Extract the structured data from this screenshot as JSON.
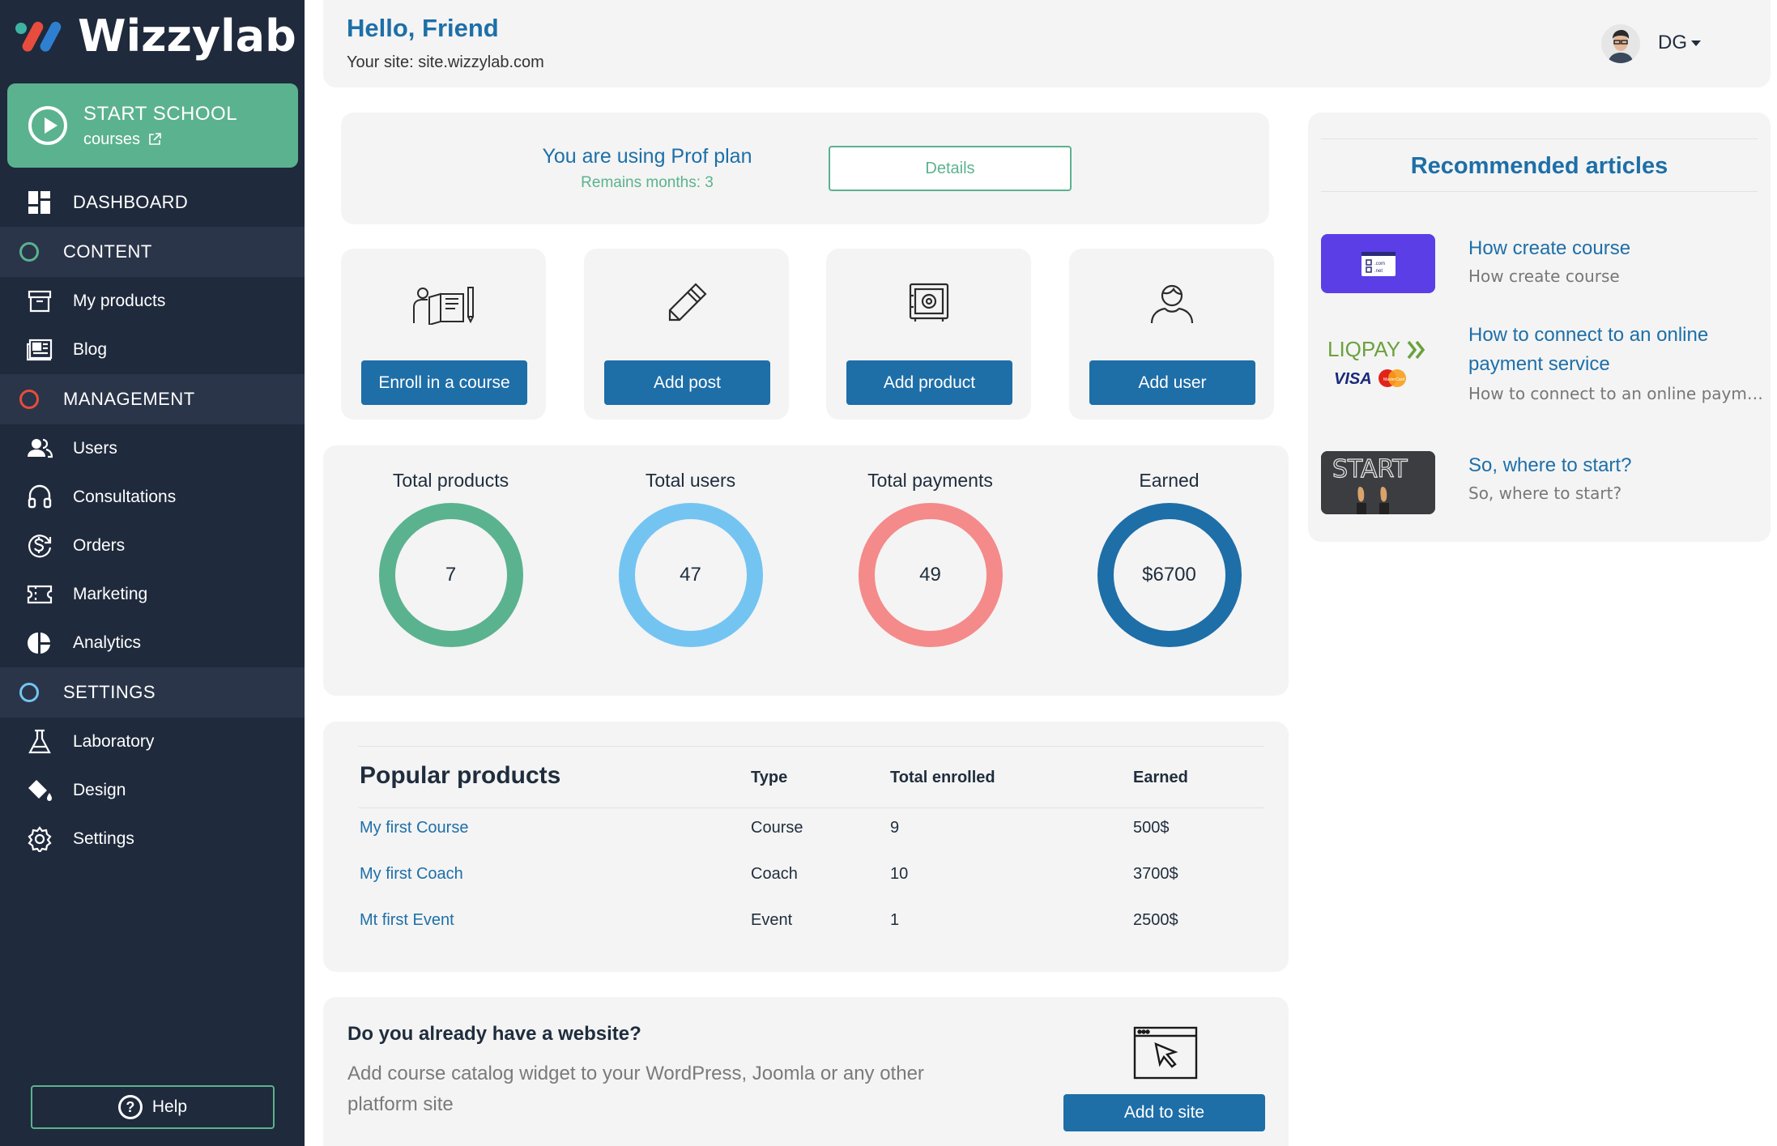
{
  "brand": {
    "name": "Wizzylab"
  },
  "start_school": {
    "title": "START SCHOOL",
    "subtitle": "courses"
  },
  "nav": {
    "dashboard": "DASHBOARD",
    "content": "CONTENT",
    "my_products": "My products",
    "blog": "Blog",
    "management": "MANAGEMENT",
    "users": "Users",
    "consultations": "Consultations",
    "orders": "Orders",
    "marketing": "Marketing",
    "analytics": "Analytics",
    "settings_section": "SETTINGS",
    "laboratory": "Laboratory",
    "design": "Design",
    "settings": "Settings"
  },
  "help": {
    "label": "Help"
  },
  "header": {
    "greeting": "Hello, Friend",
    "site_prefix": "Your site:",
    "site_url": "site.wizzylab.com",
    "user_initials": "DG"
  },
  "plan": {
    "title": "You are using Prof plan",
    "remains": "Remains months: 3",
    "details_label": "Details"
  },
  "actions": [
    {
      "label": "Enroll in a course",
      "icon": "book-reader-icon"
    },
    {
      "label": "Add post",
      "icon": "pencil-icon"
    },
    {
      "label": "Add product",
      "icon": "safe-icon"
    },
    {
      "label": "Add user",
      "icon": "user-icon"
    }
  ],
  "stats": [
    {
      "label": "Total products",
      "value": "7",
      "color": "#5bb28f"
    },
    {
      "label": "Total users",
      "value": "47",
      "color": "#74c4f2"
    },
    {
      "label": "Total payments",
      "value": "49",
      "color": "#f48a8a"
    },
    {
      "label": "Earned",
      "value": "$6700",
      "color": "#1e6ea8"
    }
  ],
  "popular": {
    "title": "Popular products",
    "columns": [
      "Type",
      "Total enrolled",
      "Earned"
    ],
    "rows": [
      {
        "name": "My first Course",
        "type": "Course",
        "enrolled": "9",
        "earned": "500$"
      },
      {
        "name": "My first Coach",
        "type": "Coach",
        "enrolled": "10",
        "earned": "3700$"
      },
      {
        "name": "Mt first Event",
        "type": "Event",
        "enrolled": "1",
        "earned": "2500$"
      }
    ]
  },
  "website": {
    "title": "Do you already have a website?",
    "description": "Add course catalog widget to your WordPress, Joomla or any other platform site",
    "button": "Add to site"
  },
  "articles": {
    "title": "Recommended articles",
    "items": [
      {
        "title": "How create course",
        "subtitle": "How create course"
      },
      {
        "title": "How to connect to an online payment service",
        "subtitle": "How to connect to an online payment service"
      },
      {
        "title": "So, where to start?",
        "subtitle": "So, where to start?"
      }
    ],
    "thumb_text": {
      "liqpay": "LIQPAY",
      "visa": "VISA",
      "mastercard": "MasterCard",
      "start": "START",
      "dotcom": ".com",
      "dotnet": ".net"
    }
  },
  "colors": {
    "sidebar": "#1f2a3c",
    "accent_green": "#5bb28f",
    "primary_blue": "#1e6ea8",
    "link_blue": "#1d6fa8",
    "management_red": "#e74c3c",
    "settings_blue": "#74c4f2"
  }
}
